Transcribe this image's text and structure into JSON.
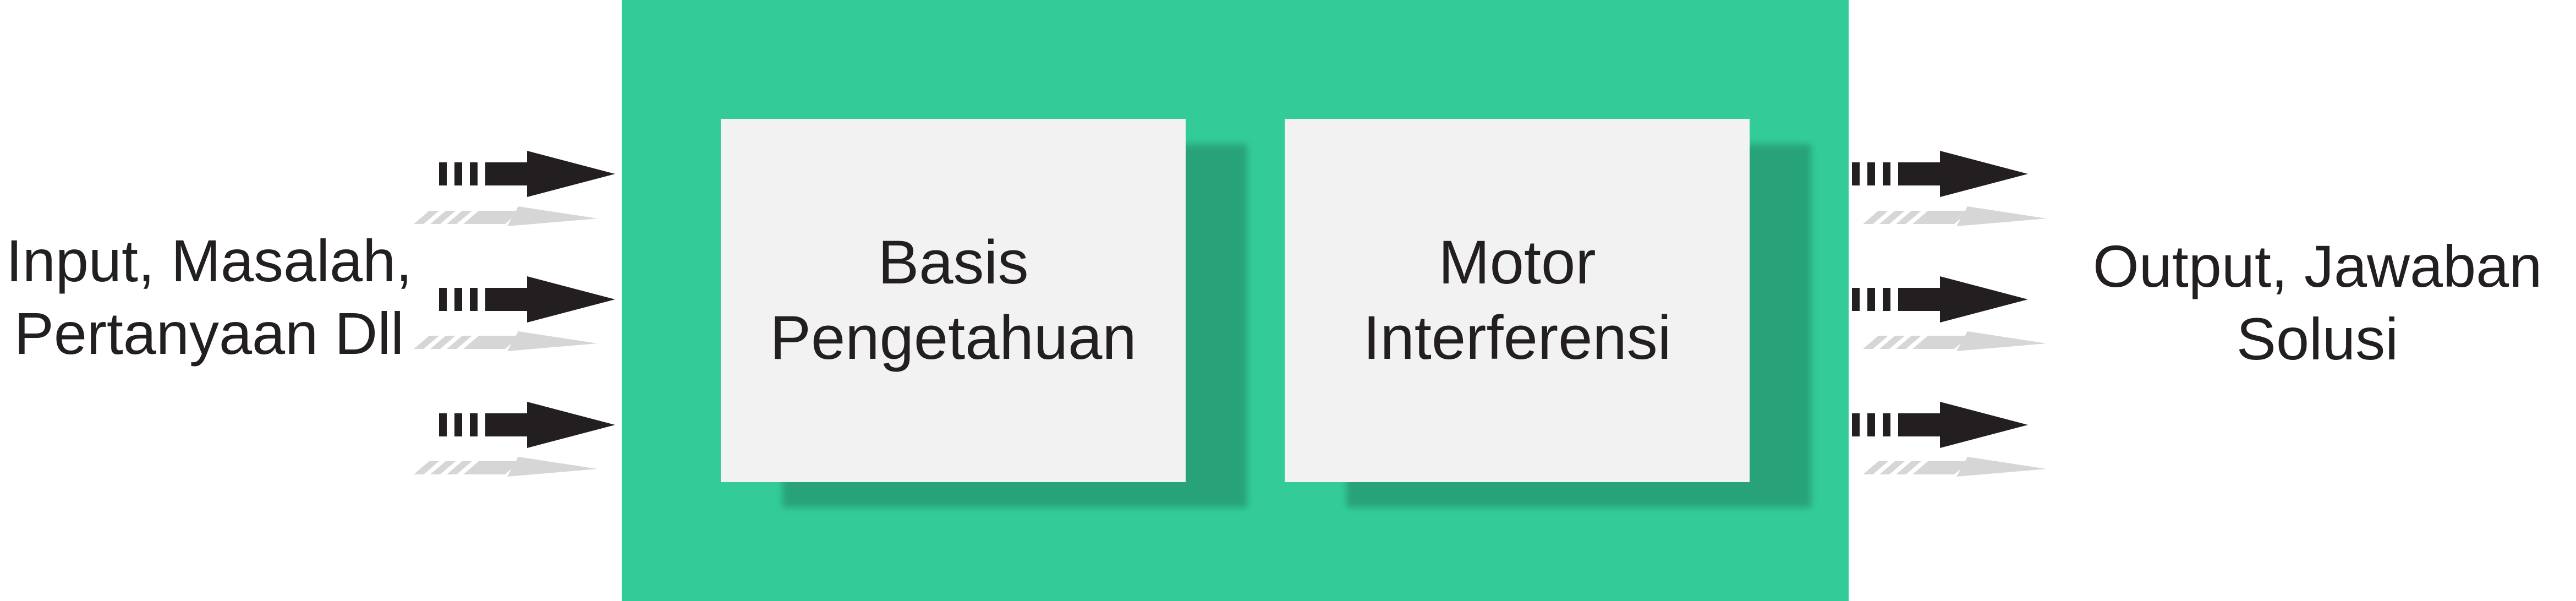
{
  "input": {
    "line1": "Input, Masalah,",
    "line2": "Pertanyaan Dll"
  },
  "components": {
    "knowledge_base": {
      "line1": "Basis",
      "line2": "Pengetahuan"
    },
    "inference_engine": {
      "line1": "Motor",
      "line2": "Interferensi"
    }
  },
  "output": {
    "line1": "Output, Jawaban",
    "line2": "Solusi"
  },
  "colors": {
    "system_box": "#33cc99",
    "panel_shadow": "#28a279",
    "panel_fill": "#f2f2f2",
    "arrow": "#231f20",
    "arrow_reflection": "#d6d6d6",
    "text": "#231f20"
  },
  "icons": {
    "input_arrows": [
      "dashed-arrow-right-icon",
      "dashed-arrow-right-icon",
      "dashed-arrow-right-icon"
    ],
    "output_arrows": [
      "dashed-arrow-right-icon",
      "dashed-arrow-right-icon",
      "dashed-arrow-right-icon"
    ]
  }
}
